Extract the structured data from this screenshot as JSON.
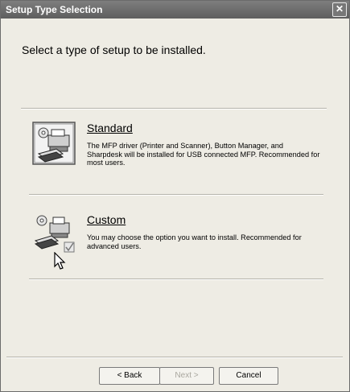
{
  "window": {
    "title": "Setup Type Selection",
    "close_glyph": "✕"
  },
  "heading": "Select a type of setup to be installed.",
  "options": [
    {
      "icon": "printer-scanner-icon",
      "title": "Standard",
      "description": "The MFP driver (Printer and Scanner), Button Manager, and Sharpdesk will be installed for USB connected MFP. Recommended for most users."
    },
    {
      "icon": "printer-scanner-checkbox-icon",
      "title": "Custom",
      "description": "You may choose the option you want to install. Recommended for advanced users."
    }
  ],
  "buttons": {
    "back_label": "< Back",
    "next_label": "Next >",
    "cancel_label": "Cancel",
    "next_enabled": false
  }
}
